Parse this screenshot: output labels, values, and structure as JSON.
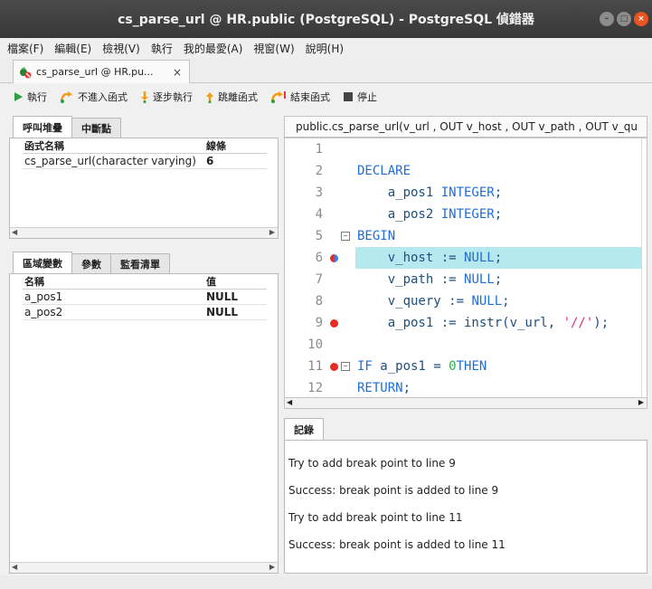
{
  "window": {
    "title": "cs_parse_url @ HR.public (PostgreSQL) - PostgreSQL 偵錯器"
  },
  "menu": [
    "檔案(F)",
    "編輯(E)",
    "檢視(V)",
    "執行",
    "我的最愛(A)",
    "視窗(W)",
    "說明(H)"
  ],
  "doc_tab": {
    "label": "cs_parse_url @ HR.pu...",
    "close": "×"
  },
  "toolbar": {
    "run": "執行",
    "step_over": "不進入函式",
    "step_into": "逐步執行",
    "step_out": "跳離函式",
    "finish": "結束函式",
    "stop": "停止"
  },
  "callstack": {
    "tabs": [
      "呼叫堆疊",
      "中斷點"
    ],
    "headers": [
      "函式名稱",
      "線條"
    ],
    "rows": [
      {
        "name": "cs_parse_url(character varying)",
        "line": "6"
      }
    ]
  },
  "variables": {
    "tabs": [
      "區域變數",
      "參數",
      "監看清單"
    ],
    "headers": [
      "名稱",
      "值"
    ],
    "rows": [
      {
        "name": "a_pos1",
        "value": "NULL"
      },
      {
        "name": "a_pos2",
        "value": "NULL"
      }
    ]
  },
  "editor": {
    "tab_title": "public.cs_parse_url(v_url , OUT v_host , OUT v_path , OUT v_qu",
    "line_numbers": [
      "1",
      "2",
      "3",
      "4",
      "5",
      "6",
      "7",
      "8",
      "9",
      "10",
      "11",
      "12"
    ]
  },
  "log": {
    "tab": "記錄",
    "lines": [
      "Try to add break point to line 9",
      "Success: break point is added to line 9",
      "Try to add break point to line 11",
      "Success: break point is added to line 11"
    ]
  },
  "colors": {
    "current_line": "#b5e8ef",
    "breakpoint": "#e82c1f",
    "keyword": "#1f6dd6",
    "string": "#e02b76",
    "number": "#2bb24c"
  }
}
